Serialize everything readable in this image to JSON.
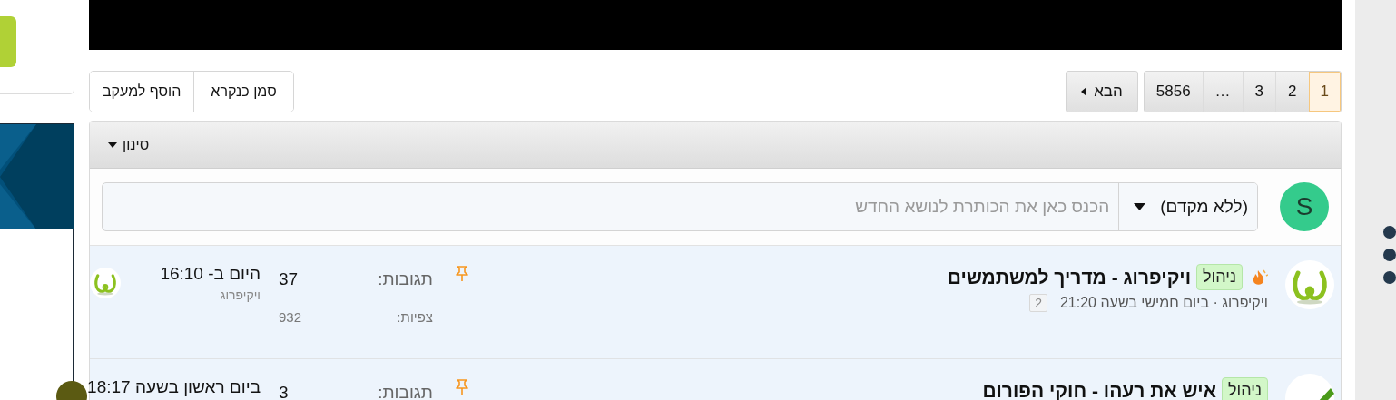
{
  "thread_actions": [
    {
      "label": "סמן כנקרא"
    },
    {
      "label": "הוסף למעקב"
    }
  ],
  "pagination": {
    "pages": [
      {
        "label": "1",
        "selected": true
      },
      {
        "label": "2",
        "selected": false
      },
      {
        "label": "3",
        "selected": false
      },
      {
        "label": "…",
        "selected": false
      },
      {
        "label": "5856",
        "selected": false
      }
    ],
    "next": "הבא"
  },
  "filter": {
    "label": "סינון"
  },
  "new_thread": {
    "avatar_letter": "S",
    "prefix": "(ללא מקדם)",
    "placeholder": "הכנס כאן את הכותרת לנושא החדש"
  },
  "threads": [
    {
      "avatar": {
        "kind": "logo"
      },
      "hot": true,
      "badge": "ניהול",
      "title": "ויקיפרוג - מדריך למשתמשים",
      "meta": "ויקיפרוג · ביום חמישי בשעה 21:20",
      "pages": [
        "2"
      ],
      "pinned": true,
      "replies_label": "תגובות:",
      "replies": "37",
      "views_label": "צפיות:",
      "views": "932",
      "last_time": "היום ב- 16:10",
      "last_user": "ויקיפרוג",
      "last_avatar": {
        "kind": "logo"
      }
    },
    {
      "avatar": {
        "kind": "check"
      },
      "hot": false,
      "badge": "ניהול",
      "title": "איש את רעהו - חוקי הפורום",
      "pinned": true,
      "replies_label": "תגובות:",
      "replies": "3",
      "last_time": "ביום ראשון בשעה 18:17",
      "last_avatar": {
        "kind": "initial"
      }
    }
  ]
}
